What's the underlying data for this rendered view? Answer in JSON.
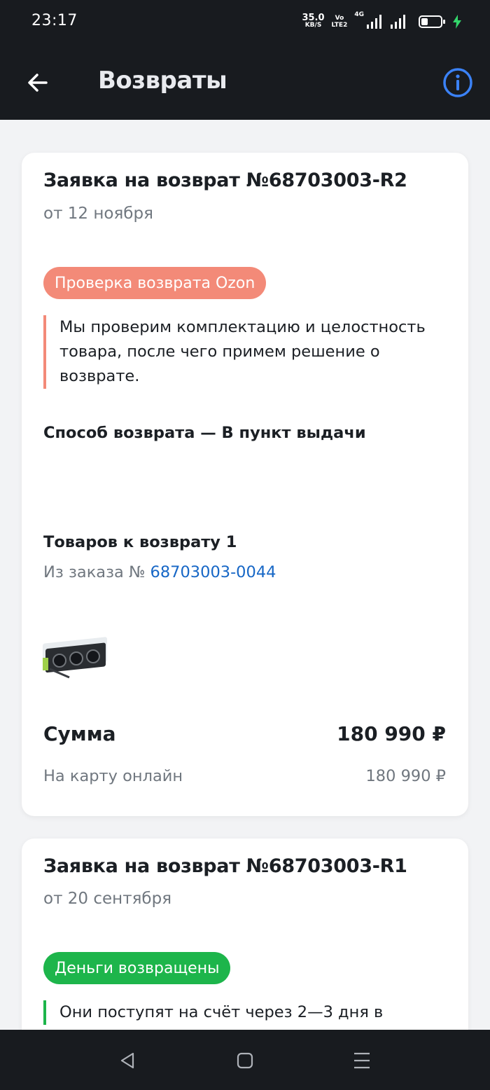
{
  "status_bar": {
    "time": "23:17",
    "net_speed": "35.0",
    "net_unit": "KB/S",
    "volte_top": "Vo",
    "volte_bottom": "LTE2",
    "network": "4G"
  },
  "header": {
    "title": "Возвраты",
    "back_icon": "arrow-left-icon",
    "info_icon": "info-icon"
  },
  "returns": [
    {
      "title": "Заявка на возврат №68703003-R2",
      "date": "от 12 ноября",
      "status": "Проверка возврата Ozon",
      "status_color": "#f38a78",
      "note": "Мы проверим комплектацию и целостность товара, после чего примем решение о возврате.",
      "method": "Способ возврата — В пункт выдачи",
      "items_title": "Товаров к возврату  1",
      "order_prefix": "Из заказа № ",
      "order_number": "68703003-0044",
      "sum_label": "Сумма",
      "sum_value": "180 990 ₽",
      "pay_label": "На карту онлайн",
      "pay_value": "180 990 ₽"
    },
    {
      "title": "Заявка на возврат №68703003-R1",
      "date": "от 20 сентября",
      "status": "Деньги возвращены",
      "status_color": "#1db54b",
      "note": "Они поступят на счёт через 2—3 дня в"
    }
  ],
  "nav_bar": {
    "back": "triangle-back-icon",
    "home": "square-home-icon",
    "menu": "menu-lines-icon"
  },
  "colors": {
    "bar_bg": "#181b1f",
    "link": "#1767c6",
    "info_accent": "#3b82f6"
  }
}
